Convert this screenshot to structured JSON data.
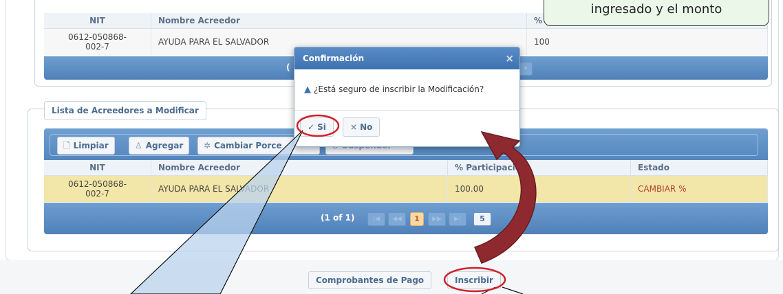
{
  "table1": {
    "headers": [
      "NIT",
      "Nombre Acreedor",
      "% Participación"
    ],
    "rows": [
      {
        "nit": "0612-050868-\n002-7",
        "nombre": "AYUDA PARA EL SALVADOR",
        "participacion": "100"
      }
    ],
    "pager_fragment": "("
  },
  "section2": {
    "legend": "Lista de Acreedores a Modificar",
    "toolbar": {
      "limpiar": "Limpiar",
      "agregar": "Agregar",
      "cambiar": "Cambiar Porce",
      "extra": "Suspender"
    },
    "headers": [
      "NIT",
      "Nombre Acreedor",
      "% Participación",
      "Estado"
    ],
    "rows": [
      {
        "nit": "0612-050868-\n002-7",
        "nombre": "AYUDA PARA EL SALVADOR",
        "participacion": "100.00",
        "estado": "CAMBIAR %"
      }
    ],
    "pager": {
      "summary": "(1 of 1)",
      "first": "|◀",
      "prev": "◀◀",
      "current": "1",
      "next": "▶▶",
      "last": "▶|",
      "rows": "5"
    }
  },
  "dialog": {
    "title": "Confirmación",
    "close": "×",
    "message": "¿Está seguro de inscribir la Modificación?",
    "yes": "Si",
    "no": "No"
  },
  "footer": {
    "comprobantes": "Comprobantes de Pago",
    "inscribir": "Inscribir"
  },
  "callout": {
    "text": "ingresado y el monto"
  },
  "colors": {
    "accent": "#4f80b8",
    "highlight_row": "#f2e6a8",
    "estado": "#b0442b",
    "annotation_red": "#d0202a"
  }
}
